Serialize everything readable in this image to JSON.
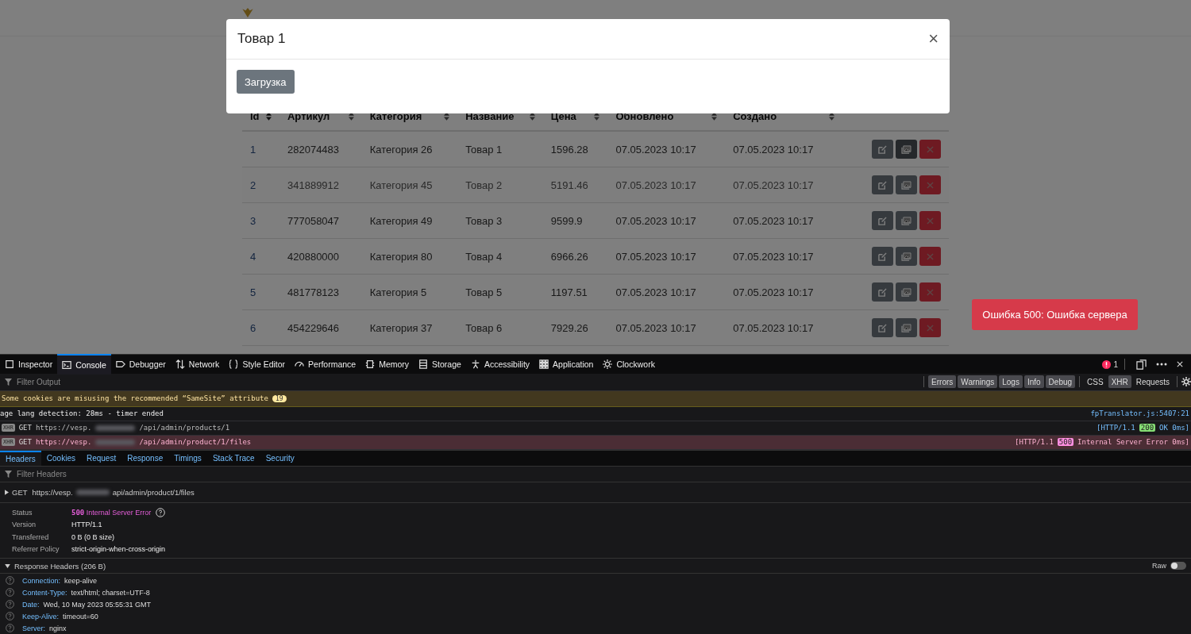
{
  "table": {
    "columns": [
      "Id",
      "Артикул",
      "Категория",
      "Название",
      "Цена",
      "Обновлено",
      "Создано"
    ],
    "rows": [
      {
        "cells": [
          "1",
          "282074483",
          "Категория 26",
          "Товар 1",
          "1596.28",
          "07.05.2023 10:17",
          "07.05.2023 10:17"
        ],
        "hovered": false
      },
      {
        "cells": [
          "2",
          "341889912",
          "Категория 45",
          "Товар 2",
          "5191.46",
          "07.05.2023 10:17",
          "07.05.2023 10:17"
        ],
        "hovered": true
      },
      {
        "cells": [
          "3",
          "777058047",
          "Категория 49",
          "Товар 3",
          "9599.9",
          "07.05.2023 10:17",
          "07.05.2023 10:17"
        ],
        "hovered": false
      },
      {
        "cells": [
          "4",
          "420880000",
          "Категория 80",
          "Товар 4",
          "6966.26",
          "07.05.2023 10:17",
          "07.05.2023 10:17"
        ],
        "hovered": false
      },
      {
        "cells": [
          "5",
          "481778123",
          "Категория 5",
          "Товар 5",
          "1197.51",
          "07.05.2023 10:17",
          "07.05.2023 10:17"
        ],
        "hovered": false
      },
      {
        "cells": [
          "6",
          "454229646",
          "Категория 37",
          "Товар 6",
          "7929.26",
          "07.05.2023 10:17",
          "07.05.2023 10:17"
        ],
        "hovered": false
      }
    ]
  },
  "modal": {
    "title": "Товар 1",
    "close": "×",
    "button": "Загрузка"
  },
  "toast": "Ошибка 500: Ошибка сервера",
  "devtools": {
    "tabs": [
      {
        "label": "Inspector",
        "selected": false
      },
      {
        "label": "Console",
        "selected": true
      },
      {
        "label": "Debugger",
        "selected": false
      },
      {
        "label": "Network",
        "selected": false
      },
      {
        "label": "Style Editor",
        "selected": false
      },
      {
        "label": "Performance",
        "selected": false
      },
      {
        "label": "Memory",
        "selected": false
      },
      {
        "label": "Storage",
        "selected": false
      },
      {
        "label": "Accessibility",
        "selected": false
      },
      {
        "label": "Application",
        "selected": false
      },
      {
        "label": "Clockwork",
        "selected": false
      }
    ],
    "error_count": "1",
    "filter_placeholder": "Filter Output",
    "filters": [
      {
        "label": "Errors",
        "on": true
      },
      {
        "label": "Warnings",
        "on": true
      },
      {
        "label": "Logs",
        "on": true
      },
      {
        "label": "Info",
        "on": true
      },
      {
        "label": "Debug",
        "on": true
      }
    ],
    "extra_filters": [
      {
        "label": "CSS",
        "on": false
      },
      {
        "label": "XHR",
        "on": true
      },
      {
        "label": "Requests",
        "on": false
      }
    ],
    "messages": [
      {
        "kind": "warning",
        "text": "Some cookies are misusing the recommended “SameSite” attribute",
        "count": "19"
      },
      {
        "kind": "log",
        "text": "age lang detection: 28ms - timer ended",
        "source": "fpTranslator.js:5407:21"
      },
      {
        "kind": "xhr",
        "badge": "XHR",
        "method": "GET",
        "url_start": "https://vesp.",
        "url_end": "/api/admin/products/1",
        "protocol": "[HTTP/1.1",
        "status": "200",
        "status_text": "OK 0ms]",
        "error": false
      },
      {
        "kind": "xhr",
        "badge": "XHR",
        "method": "GET",
        "url_start": "https://vesp.",
        "url_end": "/api/admin/product/1/files",
        "protocol": "[HTTP/1.1",
        "status": "500",
        "status_text": "Internal Server Error 0ms]",
        "error": true
      }
    ],
    "detail_tabs": [
      {
        "label": "Headers",
        "selected": true
      },
      {
        "label": "Cookies",
        "selected": false
      },
      {
        "label": "Request",
        "selected": false
      },
      {
        "label": "Response",
        "selected": false
      },
      {
        "label": "Timings",
        "selected": false
      },
      {
        "label": "Stack Trace",
        "selected": false
      },
      {
        "label": "Security",
        "selected": false
      }
    ],
    "headers_filter_placeholder": "Filter Headers",
    "request": {
      "method": "GET",
      "url_start": "https://vesp.",
      "url_end": "api/admin/product/1/files"
    },
    "summary": [
      {
        "label": "Status",
        "value": "500 Internal Server Error",
        "kind": "status"
      },
      {
        "label": "Version",
        "value": "HTTP/1.1",
        "kind": "text"
      },
      {
        "label": "Transferred",
        "value": "0 B (0 B size)",
        "kind": "text"
      },
      {
        "label": "Referrer Policy",
        "value": "strict-origin-when-cross-origin",
        "kind": "text"
      }
    ],
    "response_headers": {
      "title": "Response Headers (206 B)",
      "raw_label": "Raw",
      "raw_on": false,
      "items": [
        {
          "name": "Connection:",
          "value": "keep-alive"
        },
        {
          "name": "Content-Type:",
          "value": "text/html; charset=UTF-8"
        },
        {
          "name": "Date:",
          "value": "Wed, 10 May 2023 05:55:31 GMT"
        },
        {
          "name": "Keep-Alive:",
          "value": "timeout=60"
        },
        {
          "name": "Server:",
          "value": "nginx"
        }
      ]
    }
  }
}
